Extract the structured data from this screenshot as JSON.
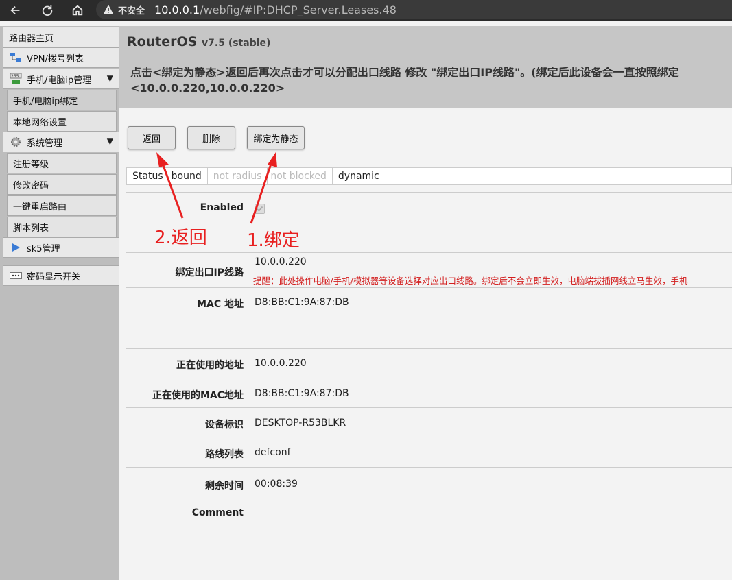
{
  "browser": {
    "insecure_label": "不安全",
    "url_host": "10.0.0.1",
    "url_path": "/webfig/#IP:DHCP_Server.Leases.48"
  },
  "sidebar": {
    "items": [
      {
        "label": "路由器主页"
      },
      {
        "label": "VPN/拨号列表"
      },
      {
        "label": "手机/电脑ip管理"
      },
      {
        "label": "手机/电脑ip绑定"
      },
      {
        "label": "本地网络设置"
      },
      {
        "label": "系统管理"
      },
      {
        "label": "注册等级"
      },
      {
        "label": "修改密码"
      },
      {
        "label": "一键重启路由"
      },
      {
        "label": "脚本列表"
      },
      {
        "label": "sk5管理"
      },
      {
        "label": "密码显示开关"
      }
    ]
  },
  "header": {
    "brand": "RouterOS",
    "version": "v7.5 (stable)",
    "notice_line1": "点击<绑定为静态>返回后再次点击才可以分配出口线路 修改 \"绑定出口IP线路\"。(绑定后此设备会一直按照绑定",
    "notice_line2": "<10.0.0.220,10.0.0.220>"
  },
  "toolbar": {
    "back_label": "返回",
    "delete_label": "删除",
    "bind_static_label": "绑定为静态"
  },
  "status": {
    "items": [
      "Status",
      "bound",
      "not radius",
      "not blocked",
      "dynamic"
    ]
  },
  "fields": {
    "enabled_label": "Enabled",
    "exit_ip_label": "绑定出口IP线路",
    "exit_ip_value": "10.0.0.220",
    "exit_ip_hint": "提醒：此处操作电脑/手机/模拟器等设备选择对应出口线路。绑定后不会立即生效，电脑端拔插网线立马生效，手机",
    "mac_label": "MAC 地址",
    "mac_value": "D8:BB:C1:9A:87:DB",
    "active_addr_label": "正在使用的地址",
    "active_addr_value": "10.0.0.220",
    "active_mac_label": "正在使用的MAC地址",
    "active_mac_value": "D8:BB:C1:9A:87:DB",
    "device_label": "设备标识",
    "device_value": "DESKTOP-R53BLKR",
    "route_label": "路线列表",
    "route_value": "defconf",
    "remaining_label": "剩余时间",
    "remaining_value": "00:08:39",
    "comment_label": "Comment"
  },
  "annotations": {
    "step1": "1.绑定",
    "step2": "2.返回",
    "color": "#e82020"
  }
}
